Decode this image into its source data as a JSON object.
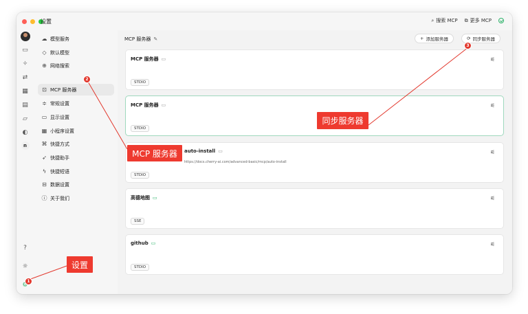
{
  "window": {
    "title": "设置"
  },
  "toolbar": {
    "search_label": "搜索 MCP",
    "more_label": "更多 MCP"
  },
  "sidebar": {
    "items": [
      {
        "icon": "cloud-icon",
        "label": "模型服务"
      },
      {
        "icon": "cube-icon",
        "label": "默认模型"
      },
      {
        "icon": "globe-icon",
        "label": "网络搜索"
      },
      {
        "icon": "terminal-icon",
        "label": "MCP 服务器"
      },
      {
        "icon": "sliders-icon",
        "label": "常规设置"
      },
      {
        "icon": "monitor-icon",
        "label": "显示设置"
      },
      {
        "icon": "grid-icon",
        "label": "小程序设置"
      },
      {
        "icon": "command-icon",
        "label": "快捷方式"
      },
      {
        "icon": "rocket-icon",
        "label": "快捷助手"
      },
      {
        "icon": "bolt-icon",
        "label": "快捷短语"
      },
      {
        "icon": "database-icon",
        "label": "数据设置"
      },
      {
        "icon": "info-icon",
        "label": "关于我们"
      }
    ]
  },
  "main": {
    "title": "MCP 服务器",
    "add_button": "添加服务器",
    "sync_button": "同步服务器",
    "cards": [
      {
        "title": "MCP 服务器",
        "desc": "",
        "tag": "STDIO"
      },
      {
        "title": "MCP 服务器",
        "desc": "",
        "tag": "STDIO"
      },
      {
        "title": "auto-install",
        "desc": "https://docs.cherry-ai.com/advanced-basic/mcp/auto-install",
        "tag": "STDIO"
      },
      {
        "title": "高德地图",
        "desc": "",
        "tag": "SSE"
      },
      {
        "title": "github",
        "desc": "",
        "tag": "STDIO"
      }
    ]
  },
  "annotations": {
    "callout_settings": "设置",
    "callout_mcp": "MCP 服务器",
    "callout_sync": "同步服务器",
    "num1": "1",
    "num2": "2",
    "num3": "3"
  },
  "colors": {
    "annotation_red": "#ee3a2f",
    "active_green": "#2fb36b"
  }
}
